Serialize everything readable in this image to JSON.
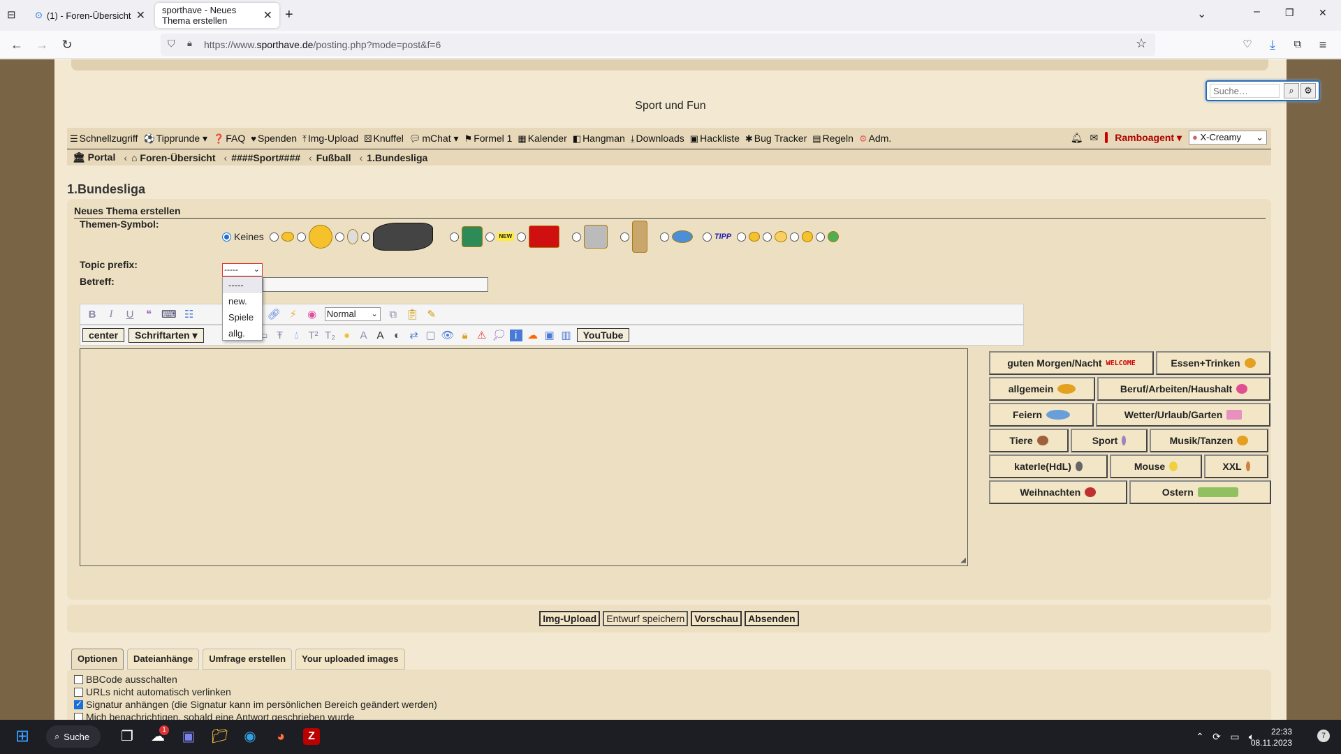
{
  "browser": {
    "tabs": [
      {
        "label": "(1) - Foren-Übersicht"
      },
      {
        "label": "sporthave - Neues Thema erstellen"
      }
    ],
    "url_prefix": "https://www.",
    "url_domain": "sporthave.de",
    "url_path": "/posting.php?mode=post&f=6"
  },
  "site": {
    "title": "Sport und Fun",
    "search_placeholder": "Suche…",
    "menu": [
      "Schnellzugriff",
      "Tipprunde",
      "FAQ",
      "Spenden",
      "Img-Upload",
      "Knuffel",
      "mChat",
      "Formel 1",
      "Kalender",
      "Hangman",
      "Downloads",
      "Hackliste",
      "Bug Tracker",
      "Regeln",
      "Adm."
    ],
    "user": "Ramboagent",
    "style_select": "X-Creamy",
    "breadcrumb": [
      "Portal",
      "Foren-Übersicht",
      "####Sport####",
      "Fußball",
      "1.Bundesliga"
    ]
  },
  "forum": {
    "page_title": "1.Bundesliga",
    "panel_title": "Neues Thema erstellen",
    "topic_icon_label": "Themen-Symbol:",
    "no_icon_label": "Keines",
    "icon_tipp": "TIPP",
    "icon_new": "NEW",
    "prefix_label": "Topic prefix:",
    "prefix_value": "-----",
    "prefix_options": [
      "-----",
      "new.",
      "Spiele",
      "allg."
    ],
    "subject_label": "Betreff:",
    "subject_value": "",
    "font_size": "Normal",
    "btn_center": "center",
    "btn_fonts": "Schriftarten",
    "btn_youtube": "YouTube",
    "smiley_categories": [
      [
        "guten Morgen/Nacht",
        "Essen+Trinken"
      ],
      [
        "allgemein",
        "Beruf/Arbeiten/Haushalt"
      ],
      [
        "Feiern",
        "Wetter/Urlaub/Garten"
      ],
      [
        "Tiere",
        "Sport",
        "Musik/Tanzen"
      ],
      [
        "katerle(HdL)",
        "Mouse",
        "XXL"
      ],
      [
        "Weihnachten",
        "Ostern"
      ]
    ],
    "welcome_text": "WELCOME",
    "submit_buttons": [
      "Img-Upload",
      "Entwurf speichern",
      "Vorschau",
      "Absenden"
    ],
    "option_tabs": [
      "Optionen",
      "Dateianhänge",
      "Umfrage erstellen",
      "Your uploaded images"
    ],
    "options": [
      {
        "label": "BBCode ausschalten",
        "checked": false
      },
      {
        "label": "URLs nicht automatisch verlinken",
        "checked": false
      },
      {
        "label": "Signatur anhängen (die Signatur kann im persönlichen Bereich geändert werden)",
        "checked": true
      },
      {
        "label": "Mich benachrichtigen, sobald eine Antwort geschrieben wurde",
        "checked": false
      }
    ]
  },
  "taskbar": {
    "search": "Suche",
    "time": "22:33",
    "date": "08.11.2023",
    "weather_badge": "1",
    "notif_count": "7"
  }
}
